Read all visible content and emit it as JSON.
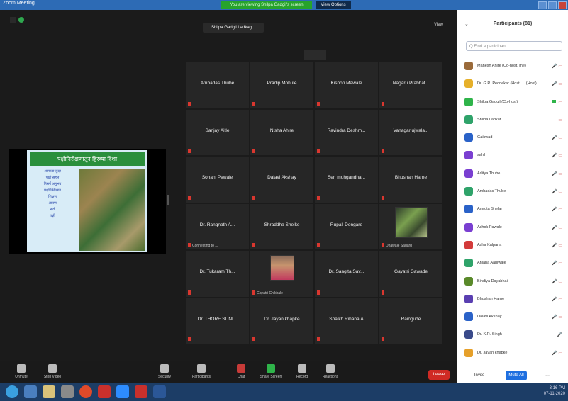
{
  "window": {
    "app_title": "Zoom Meeting",
    "share_banner": "You are viewing Shilpa Gadgil's screen",
    "view_options": "View Options"
  },
  "main": {
    "speaker_tag": "Shilpa Gadgil Ladkag...",
    "view_label": "View",
    "nav_arrow": "..."
  },
  "slide": {
    "title": "पक्षीनिरीक्षणातून हिरव्या दिशा",
    "lines": [
      "आमच्या सुंदर",
      "पक्षी सहल",
      "निसर्ग अनुभव",
      "पक्षी निरीक्षण",
      "शिक्षण",
      "आपण",
      "सर्व",
      "पक्षी"
    ]
  },
  "grid": {
    "tiles": [
      {
        "name": "Ambadas Thube",
        "sub": ""
      },
      {
        "name": "Pradip Mohule",
        "sub": ""
      },
      {
        "name": "Kishori Mawale",
        "sub": ""
      },
      {
        "name": "Nagaru Prabhat...",
        "sub": ""
      },
      {
        "name": "Sanjay Aitle",
        "sub": ""
      },
      {
        "name": "Nisha Ahire",
        "sub": ""
      },
      {
        "name": "Ravindra Deshm...",
        "sub": ""
      },
      {
        "name": "Vanagar ujwala...",
        "sub": ""
      },
      {
        "name": "Sohani Pawale",
        "sub": ""
      },
      {
        "name": "Dalavi Akshay",
        "sub": ""
      },
      {
        "name": "Ser. mohgandha...",
        "sub": ""
      },
      {
        "name": "Bhushan Harne",
        "sub": ""
      },
      {
        "name": "Dr. Rangnath A...",
        "sub": "Connecting to ..."
      },
      {
        "name": "Shraddha Shelke",
        "sub": ""
      },
      {
        "name": "Rupali Dongare",
        "sub": ""
      },
      {
        "name": "",
        "sub": "Dhawale Sagarg",
        "photo": "green"
      },
      {
        "name": "Dr. Tukaram Th...",
        "sub": ""
      },
      {
        "name": "",
        "sub": "Gayatri Chikhale",
        "photo": "person"
      },
      {
        "name": "Dr. Sangita Sav...",
        "sub": ""
      },
      {
        "name": "Gayatri Gawade",
        "sub": ""
      },
      {
        "name": "Dr. THORE SUNI...",
        "sub": ""
      },
      {
        "name": "Dr. Jayan khapke",
        "sub": ""
      },
      {
        "name": "Shaikh Rihana.A",
        "sub": ""
      },
      {
        "name": "Raingude",
        "sub": ""
      }
    ]
  },
  "toolbar": {
    "unmute": "Unmute",
    "start_video": "Stop Video",
    "security": "Security",
    "participants": "Participants",
    "participants_count": "81",
    "chat": "Chat",
    "share_screen": "Share Screen",
    "record": "Record",
    "reactions": "Reactions",
    "leave": "Leave"
  },
  "panel": {
    "title": "Participants (81)",
    "collapse": "⌄",
    "search_placeholder": "Q Find a participant",
    "participants": [
      {
        "name": "Mahesh Ahire (Co-host, me)",
        "color": "#9a6a3a",
        "icons": "🎤 ▭"
      },
      {
        "name": "Dr. G.R. Pednekar (Host, ... (Host)",
        "color": "#e6b02a",
        "icons": "🎤 ▭"
      },
      {
        "name": "Shilpa Gadgil (Co-host)",
        "color": "#2fb44a",
        "icons": "▭",
        "cam": true
      },
      {
        "name": "Shilpa Ladkat",
        "color": "#2fa36a",
        "icons": "▭"
      },
      {
        "name": "Gaikwad",
        "color": "#2a62c8",
        "icons": "🎤 ▭"
      },
      {
        "name": "sahil",
        "color": "#7a3fd1",
        "icons": "🎤 ▭"
      },
      {
        "name": "Aditya Thube",
        "color": "#7a3fd1",
        "icons": "🎤 ▭"
      },
      {
        "name": "Ambadas Thube",
        "color": "#2fa36a",
        "icons": "🎤 ▭"
      },
      {
        "name": "Amruta Shelar",
        "color": "#2a62c8",
        "icons": "🎤 ▭"
      },
      {
        "name": "Ashok Pawale",
        "color": "#7a3fd1",
        "icons": "🎤 ▭"
      },
      {
        "name": "Asha Kalpana",
        "color": "#d33a3a",
        "icons": "🎤 ▭"
      },
      {
        "name": "Anjana Aahiwale",
        "color": "#2fa36a",
        "icons": "🎤 ▭"
      },
      {
        "name": "Bindiya Dayabhai",
        "color": "#5a8a2a",
        "icons": "🎤 ▭"
      },
      {
        "name": "Bhushan Harne",
        "color": "#5a3fb1",
        "icons": "🎤 ▭"
      },
      {
        "name": "Dalavi Akshay",
        "color": "#2a62c8",
        "icons": "🎤 ▭"
      },
      {
        "name": "Dr. K.R. Singh",
        "color": "#3a4a8a",
        "icons": "🎤"
      },
      {
        "name": "Dr. Jayan khapke",
        "color": "#e6a02a",
        "icons": "🎤 ▭"
      }
    ],
    "invite": "Invite",
    "mute_all": "Mute All",
    "more": "..."
  },
  "taskbar": {
    "time": "3:16 PM",
    "date": "07-11-2020"
  },
  "colors": {
    "accent": "#1e6fe0",
    "leave": "#d02a24",
    "share_green": "#27a32b"
  }
}
